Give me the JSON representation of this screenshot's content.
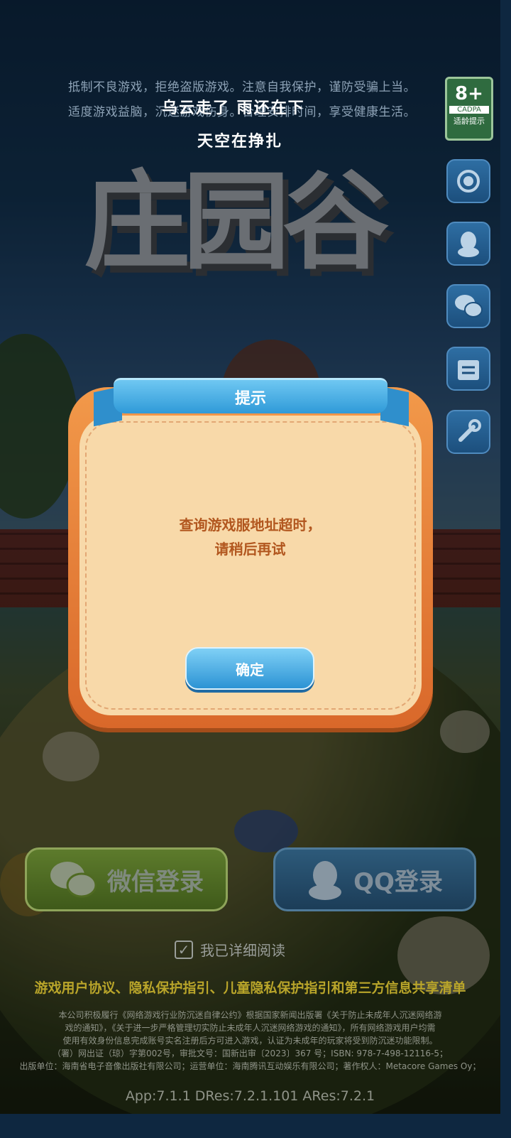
{
  "notices": {
    "line1": "抵制不良游戏，拒绝盗版游戏。注意自我保护，谨防受骗上当。",
    "line2": "适度游戏益脑，沉迷游戏伤身。合理安排时间，享受健康生活。"
  },
  "lyrics": {
    "line1": "乌云走了  雨还在下",
    "line2": "天空在挣扎"
  },
  "age_rating": {
    "value": "8+",
    "org": "CADPA",
    "label": "适龄提示"
  },
  "logo_text": "庄园谷",
  "side_buttons": [
    "customer-service-icon",
    "qq-icon",
    "wechat-icon",
    "notice-board-icon",
    "wrench-icon"
  ],
  "login": {
    "wechat_label": "微信登录",
    "qq_label": "QQ登录"
  },
  "agreement": {
    "checkbox_label": "我已详细阅读",
    "links": "游戏用户协议、隐私保护指引、儿童隐私保护指引和第三方信息共享清单"
  },
  "legal": {
    "line1": "本公司积极履行《网络游戏行业防沉迷自律公约》根据国家新闻出版署《关于防止未成年人沉迷网络游",
    "line2": "戏的通知》，《关于进一步严格管理切实防止未成年人沉迷网络游戏的通知》，所有网络游戏用户均需",
    "line3": "使用有效身份信息完成账号实名注册后方可进入游戏，认证为未成年的玩家将受到防沉迷功能限制。",
    "line4": "（署）网出证（琼）字第002号，审批文号：国新出审〔2023〕367 号；ISBN: 978-7-498-12116-5；",
    "line5": "出版单位：海南省电子音像出版社有限公司；运营单位：海南腾讯互动娱乐有限公司；著作权人：Metacore Games Oy；"
  },
  "version": "App:7.1.1 DRes:7.2.1.101 ARes:7.2.1",
  "dialog": {
    "title": "提示",
    "message_line1": "查询游戏服地址超时，",
    "message_line2": "请稍后再试",
    "ok_label": "确定"
  }
}
